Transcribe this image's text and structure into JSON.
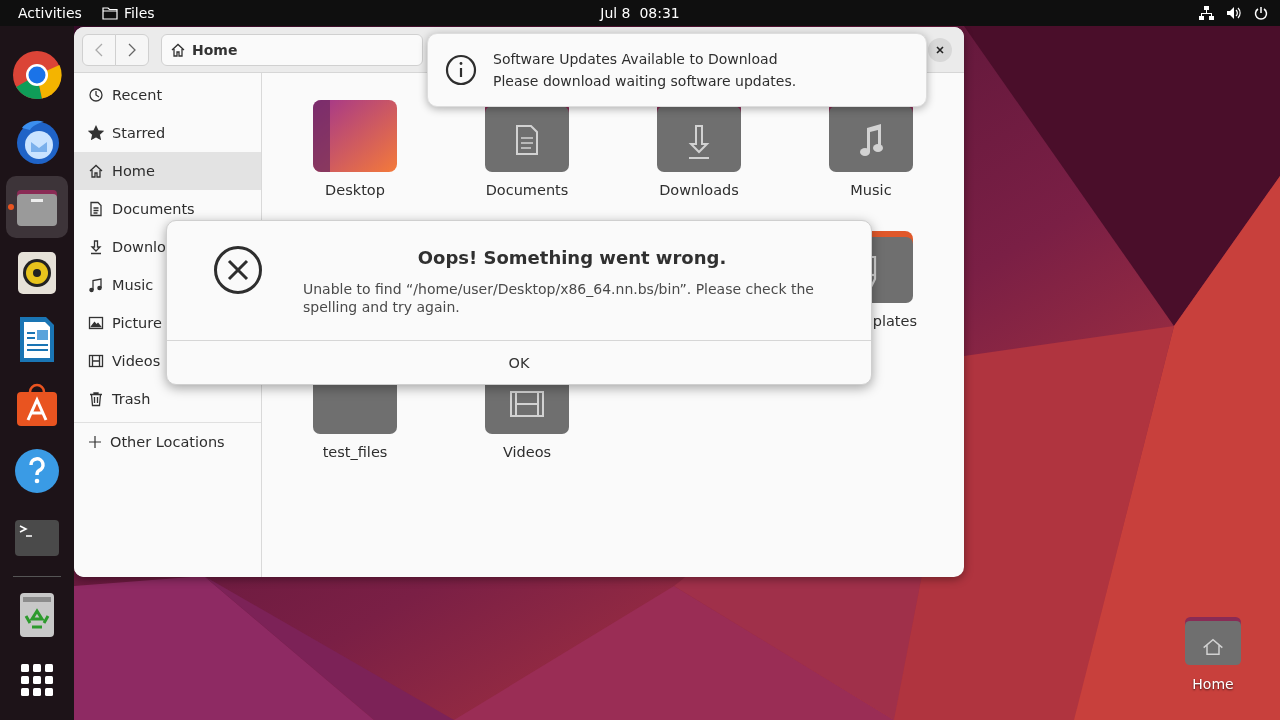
{
  "top_bar": {
    "activities": "Activities",
    "app_name": "Files",
    "clock": "Jul 8  08:31"
  },
  "dock": {
    "apps": [
      {
        "kind": "browser",
        "active": false
      },
      {
        "kind": "mail",
        "active": false
      },
      {
        "kind": "files",
        "active": true
      },
      {
        "kind": "speaker",
        "active": false
      },
      {
        "kind": "writer",
        "active": false
      },
      {
        "kind": "store",
        "active": false
      },
      {
        "kind": "help",
        "active": false
      },
      {
        "kind": "terminal",
        "active": false
      }
    ],
    "trash": {
      "kind": "trash"
    }
  },
  "files_window": {
    "location": "Home",
    "sidebar": [
      {
        "label": "Recent",
        "kind": "recent",
        "selected": false
      },
      {
        "label": "Starred",
        "kind": "starred",
        "selected": false
      },
      {
        "label": "Home",
        "kind": "home",
        "selected": true
      },
      {
        "label": "Documents",
        "kind": "documents",
        "selected": false
      },
      {
        "label": "Downlo",
        "kind": "downloads",
        "selected": false
      },
      {
        "label": "Music",
        "kind": "music",
        "selected": false
      },
      {
        "label": "Picture",
        "kind": "pictures",
        "selected": false
      },
      {
        "label": "Videos",
        "kind": "videos",
        "selected": false
      },
      {
        "label": "Trash",
        "kind": "trash",
        "selected": false
      }
    ],
    "other_locations": "Other Locations",
    "folder_rows": [
      {
        "items": [
          {
            "label": "Desktop",
            "kind": "desktop",
            "cut": false
          },
          {
            "label": "Documents",
            "kind": "documents",
            "cut": false
          },
          {
            "label": "Downloads",
            "kind": "downloads",
            "cut": false
          },
          {
            "label": "Music",
            "kind": "music",
            "cut": false
          }
        ]
      },
      {
        "items": [
          {
            "label": "plates",
            "kind": "templates",
            "cut": true
          }
        ]
      },
      {
        "items": [
          {
            "label": "test_files",
            "kind": "plain",
            "cut": false
          },
          {
            "label": "Videos",
            "kind": "videos",
            "cut": false
          }
        ]
      }
    ]
  },
  "notification": {
    "title": "Software Updates Available to Download",
    "body": "Please download waiting software updates."
  },
  "dialog": {
    "title": "Oops! Something went wrong.",
    "message": "Unable to find “/home/user/Desktop/x86_64.nn.bs/bin”. Please check the spelling and try again.",
    "button": "OK"
  },
  "desktop_icons": [
    {
      "label": "Home",
      "kind": "home"
    }
  ]
}
